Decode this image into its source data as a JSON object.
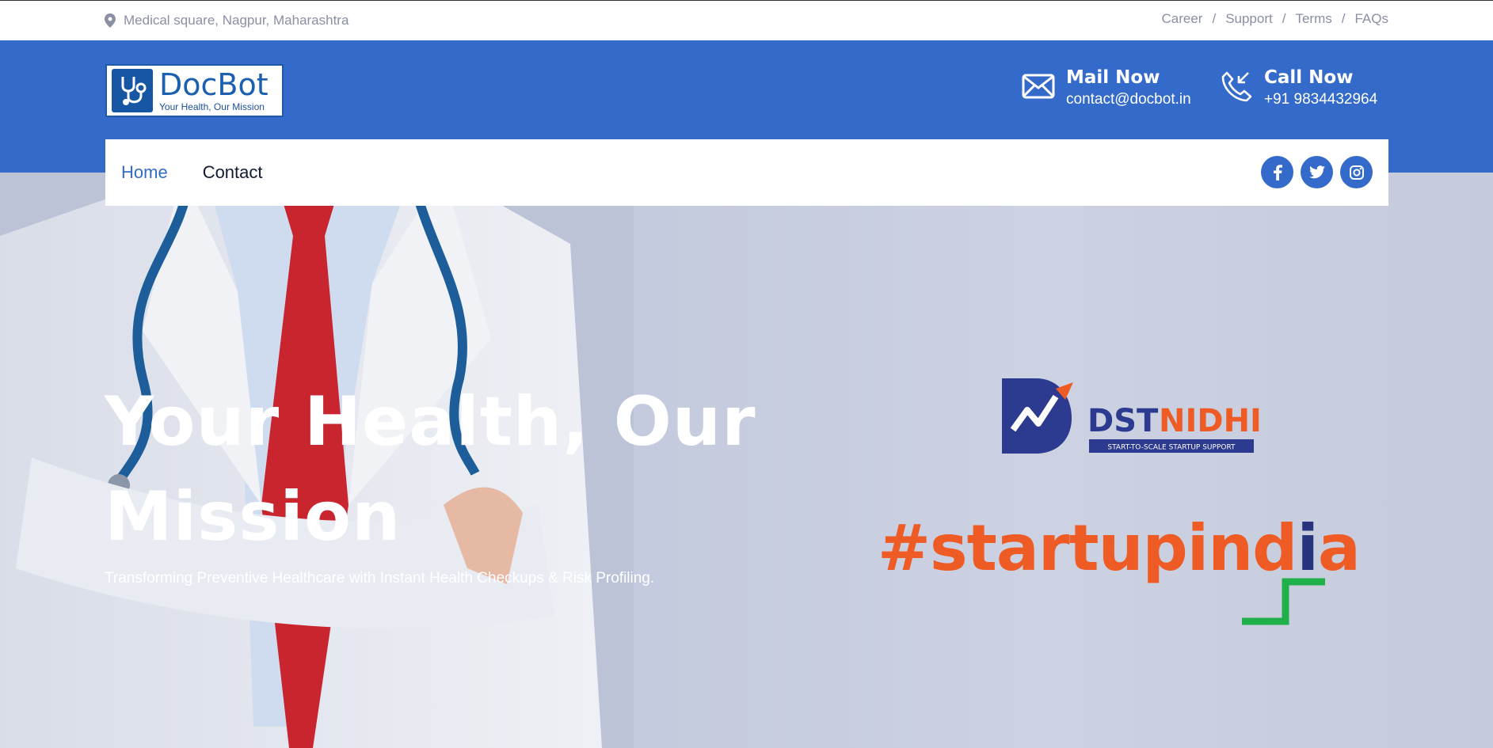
{
  "topbar": {
    "location": "Medical square, Nagpur, Maharashtra",
    "links": [
      "Career",
      "Support",
      "Terms",
      "FAQs"
    ],
    "separator": "/"
  },
  "header": {
    "logo": {
      "brand": "DocBot",
      "tagline": "Your Health, Our Mission"
    },
    "mail": {
      "title": "Mail Now",
      "value": "contact@docbot.in",
      "icon": "envelope-icon"
    },
    "call": {
      "title": "Call Now",
      "value": "+91 9834432964",
      "icon": "phone-incoming-icon"
    }
  },
  "nav": {
    "items": [
      {
        "label": "Home",
        "active": true
      },
      {
        "label": "Contact",
        "active": false
      }
    ],
    "socials": [
      "facebook-icon",
      "twitter-icon",
      "instagram-icon"
    ]
  },
  "hero": {
    "title": "Your Health, Our Mission",
    "subtitle": "Transforming Preventive Healthcare with Instant Health Checkups & Risk Profiling.",
    "partners": {
      "dst": {
        "name_dst": "DST",
        "name_nidhi": "NIDHI",
        "tagline": "START-TO-SCALE STARTUP SUPPORT"
      },
      "startupindia": {
        "text_main": "#startupind",
        "text_i": "i",
        "text_end": "a"
      }
    }
  },
  "colors": {
    "primary": "#346bca",
    "orange": "#ee5b24",
    "navy": "#27337d",
    "green": "#1fb04a"
  }
}
